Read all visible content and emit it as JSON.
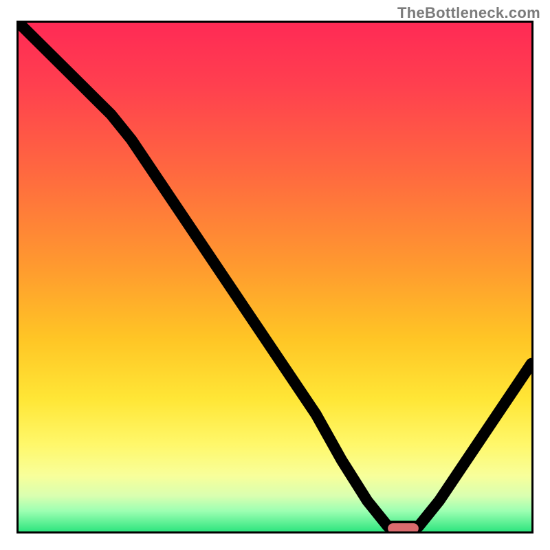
{
  "watermark": "TheBottleneck.com",
  "chart_data": {
    "type": "line",
    "title": "",
    "xlabel": "",
    "ylabel": "",
    "xlim": [
      0,
      100
    ],
    "ylim": [
      0,
      100
    ],
    "note": "Heat-map style gradient runs red (top, high bottleneck) to green (bottom, zero bottleneck). Black curve shows bottleneck% vs x; minimum around x≈72–78.",
    "series": [
      {
        "name": "bottleneck-curve",
        "x": [
          0,
          6,
          12,
          18,
          22,
          28,
          34,
          40,
          46,
          52,
          58,
          63,
          68,
          72,
          78,
          82,
          86,
          90,
          94,
          98,
          100
        ],
        "y": [
          100,
          94,
          88,
          82,
          77,
          68,
          59,
          50,
          41,
          32,
          23,
          14,
          6,
          1,
          1,
          6,
          12,
          18,
          24,
          30,
          33
        ]
      }
    ],
    "optimal_segment": {
      "x_start": 72,
      "x_end": 78,
      "y": 0.6
    },
    "marker_color": "#db6b6e",
    "gradient_stops": [
      {
        "pct": 0,
        "color": "#ff2a55"
      },
      {
        "pct": 12,
        "color": "#ff3f4f"
      },
      {
        "pct": 30,
        "color": "#ff6a3f"
      },
      {
        "pct": 48,
        "color": "#ff9a2f"
      },
      {
        "pct": 62,
        "color": "#ffc525"
      },
      {
        "pct": 74,
        "color": "#ffe636"
      },
      {
        "pct": 83,
        "color": "#fff86b"
      },
      {
        "pct": 89,
        "color": "#f8ff9a"
      },
      {
        "pct": 93,
        "color": "#d9ffb0"
      },
      {
        "pct": 96,
        "color": "#9cffb2"
      },
      {
        "pct": 100,
        "color": "#2fe57f"
      }
    ]
  }
}
